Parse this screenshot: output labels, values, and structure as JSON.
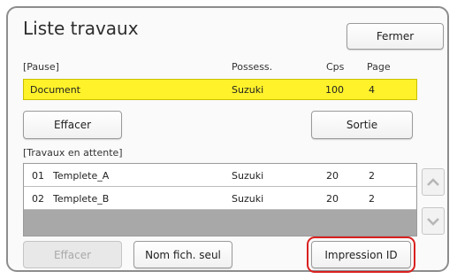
{
  "window": {
    "title": "Liste travaux",
    "close_label": "Fermer"
  },
  "paused": {
    "section_label": "[Pause]",
    "columns": {
      "owner": "Possess.",
      "copies": "Cps",
      "page": "Page"
    },
    "job": {
      "name": "Document",
      "owner": "Suzuki",
      "copies": "100",
      "page": "4"
    },
    "clear_label": "Effacer",
    "output_label": "Sortie"
  },
  "waiting": {
    "section_label": "[Travaux en attente]",
    "rows": [
      {
        "num": "01",
        "name": "Templete_A",
        "owner": "Suzuki",
        "copies": "20",
        "page": "2"
      },
      {
        "num": "02",
        "name": "Templete_B",
        "owner": "Suzuki",
        "copies": "20",
        "page": "2"
      }
    ]
  },
  "footer": {
    "clear_label": "Effacer",
    "name_only_label": "Nom fich. seul",
    "print_id_label": "Impression ID"
  },
  "colors": {
    "highlight": "#fff22a",
    "callout": "#d92020"
  },
  "icons": {
    "scroll_up": "chevron-up-icon",
    "scroll_down": "chevron-down-icon"
  }
}
